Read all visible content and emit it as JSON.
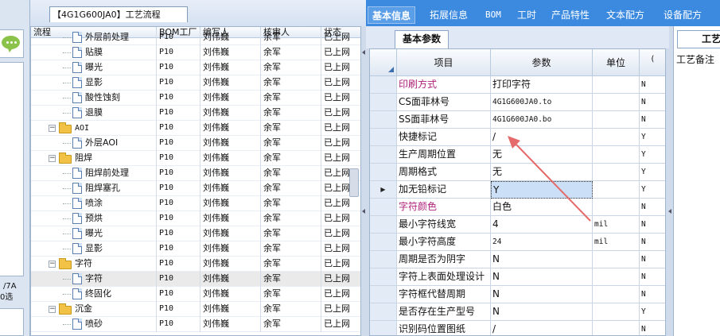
{
  "left_panel": {
    "note_line1": "/7A",
    "note_line2": "0选"
  },
  "tree_panel": {
    "tab_title": "【4G1G600JA0】工艺流程",
    "columns": [
      "流程",
      "BOM工厂",
      "编写人",
      "核审人",
      "状态"
    ],
    "rows": [
      {
        "name": "外层前处理",
        "type": "doc",
        "indent": 3,
        "factory": "P10",
        "writer": "刘伟巍",
        "reviewer": "余军",
        "status": "已上网"
      },
      {
        "name": "贴膜",
        "type": "doc",
        "indent": 3,
        "factory": "P10",
        "writer": "刘伟巍",
        "reviewer": "余军",
        "status": "已上网"
      },
      {
        "name": "曝光",
        "type": "doc",
        "indent": 3,
        "factory": "P10",
        "writer": "刘伟巍",
        "reviewer": "余军",
        "status": "已上网"
      },
      {
        "name": "显影",
        "type": "doc",
        "indent": 3,
        "factory": "P10",
        "writer": "刘伟巍",
        "reviewer": "余军",
        "status": "已上网"
      },
      {
        "name": "酸性蚀刻",
        "type": "doc",
        "indent": 3,
        "factory": "P10",
        "writer": "刘伟巍",
        "reviewer": "余军",
        "status": "已上网"
      },
      {
        "name": "退膜",
        "type": "doc",
        "indent": 3,
        "factory": "P10",
        "writer": "刘伟巍",
        "reviewer": "余军",
        "status": "已上网"
      },
      {
        "name": "AOI",
        "type": "folder",
        "indent": 1,
        "factory": "P10",
        "writer": "刘伟巍",
        "reviewer": "余军",
        "status": "已上网"
      },
      {
        "name": "外层AOI",
        "type": "doc",
        "indent": 3,
        "factory": "P10",
        "writer": "刘伟巍",
        "reviewer": "余军",
        "status": "已上网"
      },
      {
        "name": "阻焊",
        "type": "folder",
        "indent": 1,
        "factory": "P10",
        "writer": "刘伟巍",
        "reviewer": "余军",
        "status": "已上网"
      },
      {
        "name": "阻焊前处理",
        "type": "doc",
        "indent": 3,
        "factory": "P10",
        "writer": "刘伟巍",
        "reviewer": "余军",
        "status": "已上网"
      },
      {
        "name": "阻焊塞孔",
        "type": "doc",
        "indent": 3,
        "factory": "P10",
        "writer": "刘伟巍",
        "reviewer": "余军",
        "status": "已上网"
      },
      {
        "name": "喷涂",
        "type": "doc",
        "indent": 3,
        "factory": "P10",
        "writer": "刘伟巍",
        "reviewer": "余军",
        "status": "已上网"
      },
      {
        "name": "预烘",
        "type": "doc",
        "indent": 3,
        "factory": "P10",
        "writer": "刘伟巍",
        "reviewer": "余军",
        "status": "已上网"
      },
      {
        "name": "曝光",
        "type": "doc",
        "indent": 3,
        "factory": "P10",
        "writer": "刘伟巍",
        "reviewer": "余军",
        "status": "已上网"
      },
      {
        "name": "显影",
        "type": "doc",
        "indent": 3,
        "factory": "P10",
        "writer": "刘伟巍",
        "reviewer": "余军",
        "status": "已上网"
      },
      {
        "name": "字符",
        "type": "folder",
        "indent": 1,
        "factory": "P10",
        "writer": "刘伟巍",
        "reviewer": "余军",
        "status": "已上网"
      },
      {
        "name": "字符",
        "type": "doc",
        "indent": 3,
        "factory": "P10",
        "writer": "刘伟巍",
        "reviewer": "余军",
        "status": "已上网",
        "selected": true
      },
      {
        "name": "终固化",
        "type": "doc",
        "indent": 3,
        "factory": "P10",
        "writer": "刘伟巍",
        "reviewer": "余军",
        "status": "已上网"
      },
      {
        "name": "沉金",
        "type": "folder",
        "indent": 1,
        "factory": "P10",
        "writer": "刘伟巍",
        "reviewer": "余军",
        "status": "已上网"
      },
      {
        "name": "喷砂",
        "type": "doc",
        "indent": 3,
        "factory": "P10",
        "writer": "刘伟巍",
        "reviewer": "余军",
        "status": "已上网"
      }
    ]
  },
  "main_tabs": [
    "基本信息",
    "拓展信息",
    "BOM",
    "工时",
    "产品特性",
    "文本配方",
    "设备配方"
  ],
  "sub_tab": "基本参数",
  "params_grid": {
    "columns": [
      "项目",
      "参数",
      "单位",
      "("
    ],
    "rows": [
      {
        "item": "印刷方式",
        "value": "打印字符",
        "unit": "",
        "flag": "N",
        "pink": true
      },
      {
        "item": "CS面菲林号",
        "value": "4G1G600JA0.to",
        "unit": "",
        "flag": "N"
      },
      {
        "item": "SS面菲林号",
        "value": "4G1G600JA0.bo",
        "unit": "",
        "flag": "N"
      },
      {
        "item": "快捷标记",
        "value": "/",
        "unit": "",
        "flag": "Y"
      },
      {
        "item": "生产周期位置",
        "value": "无",
        "unit": "",
        "flag": "Y"
      },
      {
        "item": "周期格式",
        "value": "无",
        "unit": "",
        "flag": "Y"
      },
      {
        "item": "加无铅标记",
        "value": "Y",
        "unit": "",
        "flag": "Y",
        "current": true
      },
      {
        "item": "字符颜色",
        "value": "白色",
        "unit": "",
        "flag": "N",
        "pink": true
      },
      {
        "item": "最小字符线宽",
        "value": "4",
        "unit": "mil",
        "flag": "N"
      },
      {
        "item": "最小字符高度",
        "value": "24",
        "unit": "mil",
        "flag": "N"
      },
      {
        "item": "周期是否为阴字",
        "value": "N",
        "unit": "",
        "flag": "N"
      },
      {
        "item": "字符上表面处理设计",
        "value": "N",
        "unit": "",
        "flag": "N"
      },
      {
        "item": "字符框代替周期",
        "value": "N",
        "unit": "",
        "flag": "N"
      },
      {
        "item": "是否存在生产型号",
        "value": "N",
        "unit": "",
        "flag": "Y"
      },
      {
        "item": "识别码位置图纸",
        "value": "/",
        "unit": "",
        "flag": "N"
      }
    ]
  },
  "right_panel": {
    "tab": "工艺",
    "label": "工艺备注"
  },
  "colors": {
    "tab_bar": "#3b8ae0",
    "pink_item": "#b0207a",
    "annotation_arrow": "#e66a6a",
    "selected_cell": "#cbe0f7"
  }
}
